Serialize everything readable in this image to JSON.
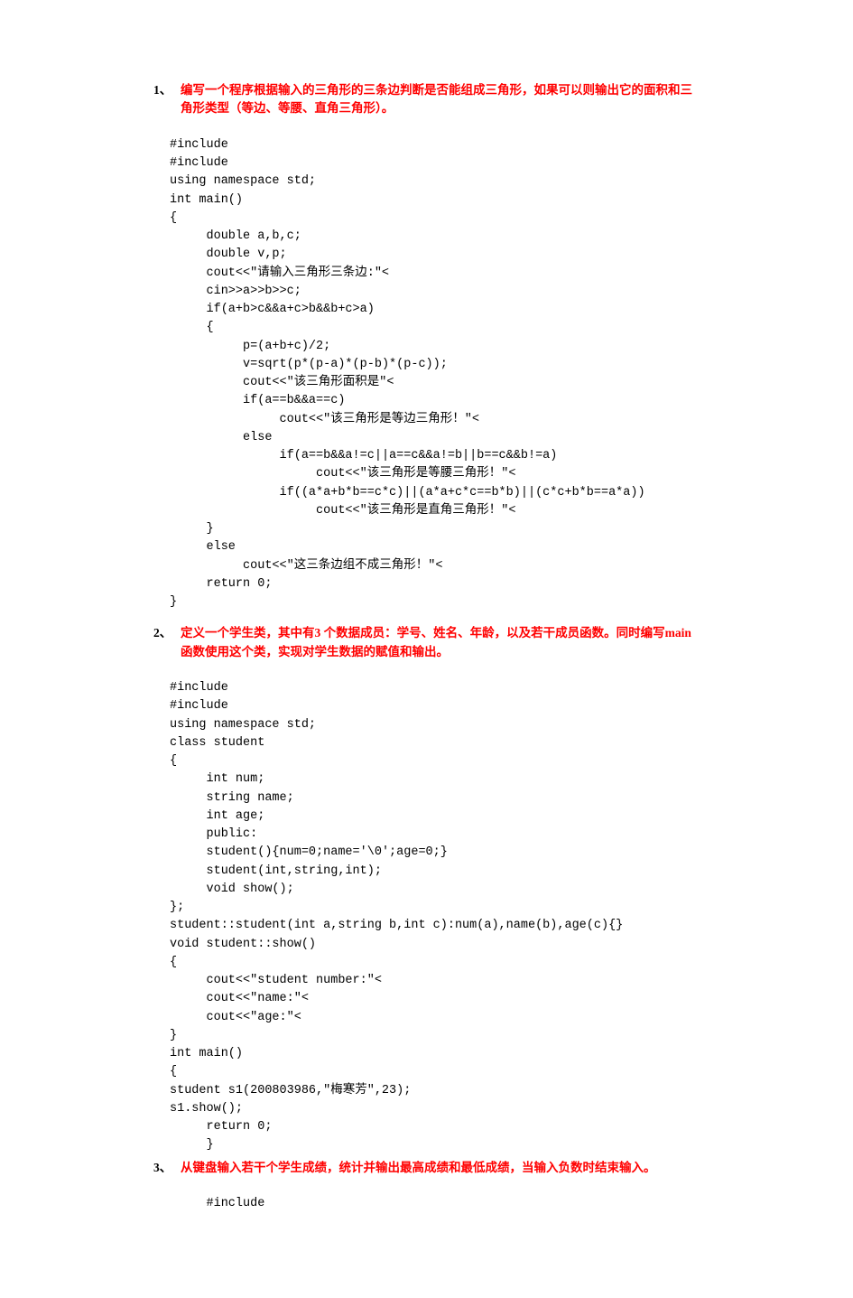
{
  "questions": [
    {
      "num": "1、",
      "title_black_prefix": "",
      "title_red": "编写一个程序根据输入的三角形的三条边判断是否能组成三角形，如果可以则输出它的面积和三角形类型（等边、等腰、直角三角形）。",
      "title_black_suffix": "",
      "code_lines": [
        "#include",
        "#include",
        "using namespace std;",
        "int main()",
        "{",
        "     double a,b,c;",
        "     double v,p;",
        "     cout<<\"请输入三角形三条边:\"<",
        "     cin>>a>>b>>c;",
        "     if(a+b>c&&a+c>b&&b+c>a)",
        "     {",
        "          p=(a+b+c)/2;",
        "          v=sqrt(p*(p-a)*(p-b)*(p-c));",
        "          cout<<\"该三角形面积是\"<",
        "          if(a==b&&a==c)",
        "               cout<<\"该三角形是等边三角形！\"<",
        "          else",
        "               if(a==b&&a!=c||a==c&&a!=b||b==c&&b!=a)",
        "                    cout<<\"该三角形是等腰三角形！\"<",
        "               if((a*a+b*b==c*c)||(a*a+c*c==b*b)||(c*c+b*b==a*a))",
        "                    cout<<\"该三角形是直角三角形！\"<",
        "     }",
        "     else",
        "          cout<<\"这三条边组不成三角形！\"<",
        "     return 0;",
        "}"
      ]
    },
    {
      "num": "2、",
      "title_black_prefix": "",
      "title_red": "定义一个学生类，其中有3 个数据成员：学号、姓名、年龄，以及若干成员函数。同时编写main 函数使用这个类，实现对学生数据的赋值和输出。",
      "title_black_suffix": "",
      "code_lines": [
        "#include",
        "#include",
        "using namespace std;",
        "class student",
        "{",
        "     int num;",
        "     string name;",
        "     int age;",
        "     public:",
        "     student(){num=0;name='\\0';age=0;}",
        "     student(int,string,int);",
        "     void show();",
        "};",
        "student::student(int a,string b,int c):num(a),name(b),age(c){}",
        "void student::show()",
        "{",
        "     cout<<\"student number:\"<",
        "     cout<<\"name:\"<",
        "     cout<<\"age:\"<",
        "}",
        "int main()",
        "{",
        "student s1(200803986,\"梅寒芳\",23);",
        "s1.show();",
        "     return 0;",
        "     }"
      ]
    },
    {
      "num": "3、",
      "title_black_prefix": "",
      "title_red": "从键盘输入若干个学生成绩，统计并输出最高成绩和最低成绩，当输入负数时结束输入。",
      "title_black_suffix": "",
      "code_lines": [
        "     #include"
      ]
    }
  ]
}
